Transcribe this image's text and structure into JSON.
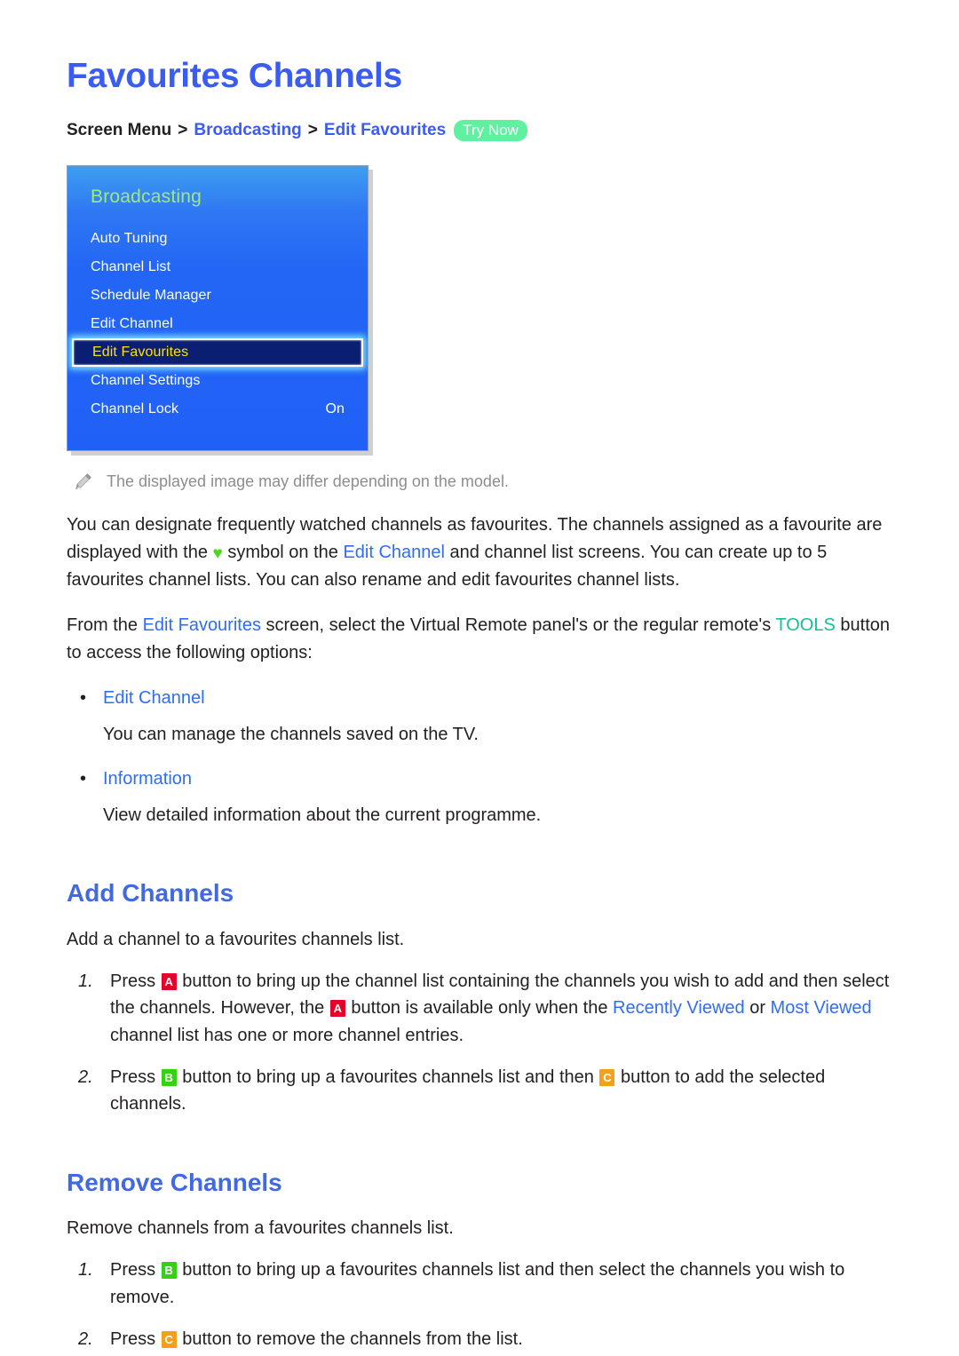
{
  "page": {
    "title": "Favourites Channels"
  },
  "breadcrumb": {
    "root": "Screen Menu",
    "sep": ">",
    "level1": "Broadcasting",
    "level2": "Edit Favourites",
    "try_now": "Try Now"
  },
  "tv_menu": {
    "panel_title": "Broadcasting",
    "selected_index": 4,
    "items": [
      {
        "label": "Auto Tuning",
        "value": ""
      },
      {
        "label": "Channel List",
        "value": ""
      },
      {
        "label": "Schedule Manager",
        "value": ""
      },
      {
        "label": "Edit Channel",
        "value": ""
      },
      {
        "label": "Edit Favourites",
        "value": ""
      },
      {
        "label": "Channel Settings",
        "value": ""
      },
      {
        "label": "Channel Lock",
        "value": "On"
      }
    ]
  },
  "note": {
    "icon": "pencil-icon",
    "text": "The displayed image may differ depending on the model."
  },
  "intro": {
    "part1": "You can designate frequently watched channels as favourites. The channels assigned as a favourite are displayed with the ",
    "heart": "♥",
    "part2": " symbol on the ",
    "link1": "Edit Channel",
    "part3": " and channel list screens. You can create up to 5 favourites channel lists. You can also rename and edit favourites channel lists."
  },
  "tools_para": {
    "part1": "From the ",
    "link1": "Edit Favourites",
    "part2": " screen, select the Virtual Remote panel's or the regular remote's ",
    "tools": "TOOLS",
    "part3": " button to access the following options:"
  },
  "options": [
    {
      "bullet": "•",
      "label": "Edit Channel",
      "desc": "You can manage the channels saved on the TV."
    },
    {
      "bullet": "•",
      "label": "Information",
      "desc": "View detailed information about the current programme."
    }
  ],
  "add_channels": {
    "heading": "Add Channels",
    "intro": "Add a channel to a favourites channels list.",
    "steps": [
      {
        "num": "1.",
        "p1": "Press ",
        "key1": "A",
        "p2": " button to bring up the channel list containing the channels you wish to add and then select the channels. However, the ",
        "key2": "A",
        "p3": " button is available only when the ",
        "link1": "Recently Viewed",
        "p4": " or ",
        "link2": "Most Viewed",
        "p5": " channel list has one or more channel entries."
      },
      {
        "num": "2.",
        "p1": "Press ",
        "key1": "B",
        "p2": " button to bring up a favourites channels list and then ",
        "key2": "C",
        "p3": " button to add the selected channels."
      }
    ]
  },
  "remove_channels": {
    "heading": "Remove Channels",
    "intro": "Remove channels from a favourites channels list.",
    "steps": [
      {
        "num": "1.",
        "p1": "Press ",
        "key1": "B",
        "p2": " button to bring up a favourites channels list and then select the channels you wish to remove."
      },
      {
        "num": "2.",
        "p1": "Press ",
        "key1": "C",
        "p2": " button to remove the channels from the list."
      }
    ]
  },
  "colors": {
    "heading_blue": "#4169e1",
    "title_blue": "#3a5cf0",
    "link_blue": "#2f6df5",
    "tools_teal": "#17bd99",
    "try_now_green": "#5ef2a0",
    "key_a_red": "#e4022b",
    "key_b_green": "#34d211",
    "key_c_orange": "#f5a01a",
    "menu_blue": "#2366f5",
    "menu_title_green": "#9fe87f",
    "selected_yellow": "#ffe100",
    "selected_navy": "#0b1f72",
    "heart_green": "#4fd51a"
  }
}
